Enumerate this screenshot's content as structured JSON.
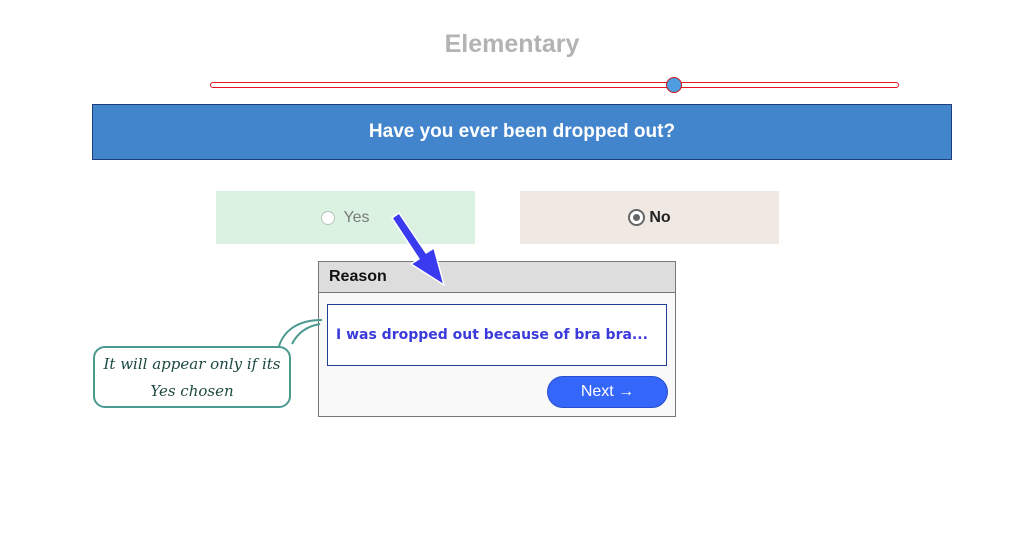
{
  "level": {
    "title": "Elementary",
    "slider_value_fraction": 0.67
  },
  "question": {
    "text": "Have you ever been dropped out?"
  },
  "options": [
    {
      "label": "Yes",
      "selected": false
    },
    {
      "label": "No",
      "selected": true
    }
  ],
  "reason_panel": {
    "header": "Reason",
    "input_value": "I was dropped out because of bra bra...",
    "next_label": "Next →"
  },
  "annotation": {
    "text": "It will appear only if its Yes chosen"
  },
  "colors": {
    "question_bar": "#4385cc",
    "yes_background": "#dbf2e3",
    "no_background": "#f0e8e3",
    "next_button": "#3566fa",
    "slider_track_border": "#e0161c",
    "slider_thumb": "#4d9de0",
    "pointer_arrow": "#3a3af0",
    "callout_border": "#4a9a8f"
  }
}
